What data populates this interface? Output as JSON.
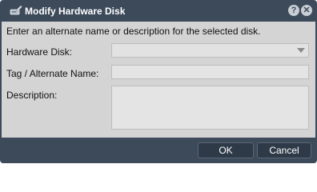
{
  "dialog": {
    "title": "Modify Hardware Disk",
    "help_symbol": "?",
    "close_symbol": "✕"
  },
  "form": {
    "instructions": "Enter an alternate name or description for the selected disk.",
    "hardware_disk": {
      "label": "Hardware Disk:",
      "value": ""
    },
    "tag": {
      "label": "Tag / Alternate Name:",
      "value": ""
    },
    "description": {
      "label": "Description:",
      "value": ""
    }
  },
  "footer": {
    "ok_label": "OK",
    "cancel_label": "Cancel"
  }
}
